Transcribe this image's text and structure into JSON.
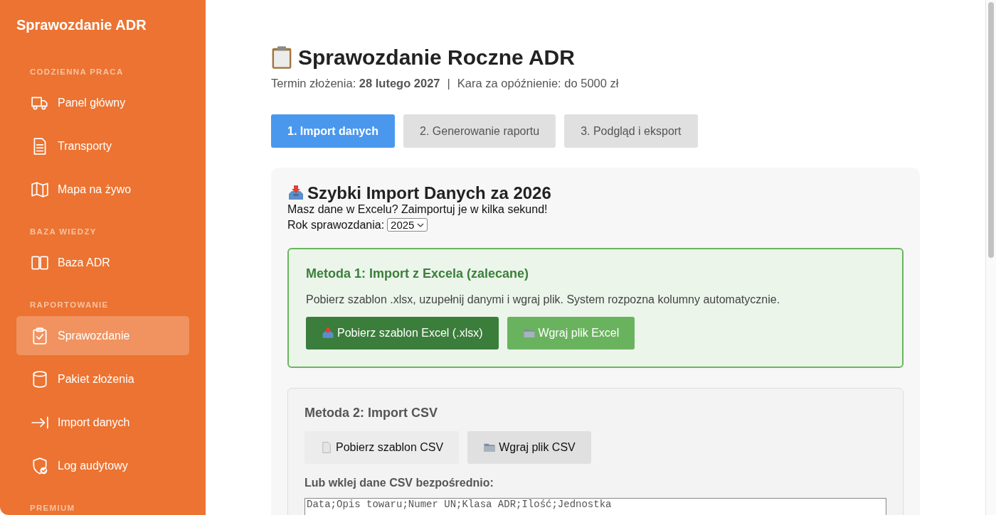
{
  "sidebar": {
    "title": "Sprawozdanie ADR",
    "sections": [
      {
        "heading": "CODZIENNA PRACA",
        "items": [
          {
            "label": "Panel główny",
            "kind": "truck",
            "selected": false
          },
          {
            "label": "Transporty",
            "kind": "document",
            "selected": false
          },
          {
            "label": "Mapa na żywo",
            "kind": "map",
            "selected": false
          }
        ]
      },
      {
        "heading": "BAZA WIEDZY",
        "items": [
          {
            "label": "Baza ADR",
            "kind": "book",
            "selected": false
          }
        ]
      },
      {
        "heading": "RAPORTOWANIE",
        "items": [
          {
            "label": "Sprawozdanie",
            "kind": "clipboard",
            "selected": true
          },
          {
            "label": "Pakiet złożenia",
            "kind": "database",
            "selected": false
          },
          {
            "label": "Import danych",
            "kind": "import",
            "selected": false
          },
          {
            "label": "Log audytowy",
            "kind": "shield",
            "selected": false
          }
        ]
      },
      {
        "heading": "PREMIUM"
      }
    ]
  },
  "page": {
    "title": "Sprawozdanie Roczne ADR",
    "deadline_label": "Termin złożenia:",
    "deadline": "28 lutego 2027",
    "separator": "|",
    "penalty": "Kara za opóźnienie: do 5000 zł"
  },
  "steps": [
    {
      "label": "1. Import danych",
      "selected": true
    },
    {
      "label": "2. Generowanie raportu",
      "selected": false
    },
    {
      "label": "3. Podgląd i eksport",
      "selected": false
    }
  ],
  "import": {
    "title": "Szybki Import Danych za 2026",
    "subtitle": "Masz dane w Excelu? Zaimportuj je w kilka sekund!",
    "year_label": "Rok sprawozdania:",
    "year": "2025",
    "method1": {
      "title": "Metoda 1: Import z Excela (zalecane)",
      "text": "Pobierz szablon .xlsx, uzupełnij danymi i wgraj plik. System rozpozna kolumny automatycznie.",
      "buttons": [
        {
          "label": "Pobierz szablon Excel (.xlsx)",
          "kind": "primary"
        },
        {
          "label": "Wgraj plik Excel",
          "kind": "secondary"
        }
      ]
    },
    "method2": {
      "title": "Metoda 2: Import CSV",
      "buttons": [
        {
          "label": "Pobierz szablon CSV",
          "kind": "light"
        },
        {
          "label": "Wgraj plik CSV",
          "kind": "grey"
        }
      ],
      "paste_label": "Lub wklej dane CSV bezpośrednio:",
      "placeholder": "Data;Opis towaru;Numer UN;Klasa ADR;Ilość;Jednostka"
    }
  }
}
